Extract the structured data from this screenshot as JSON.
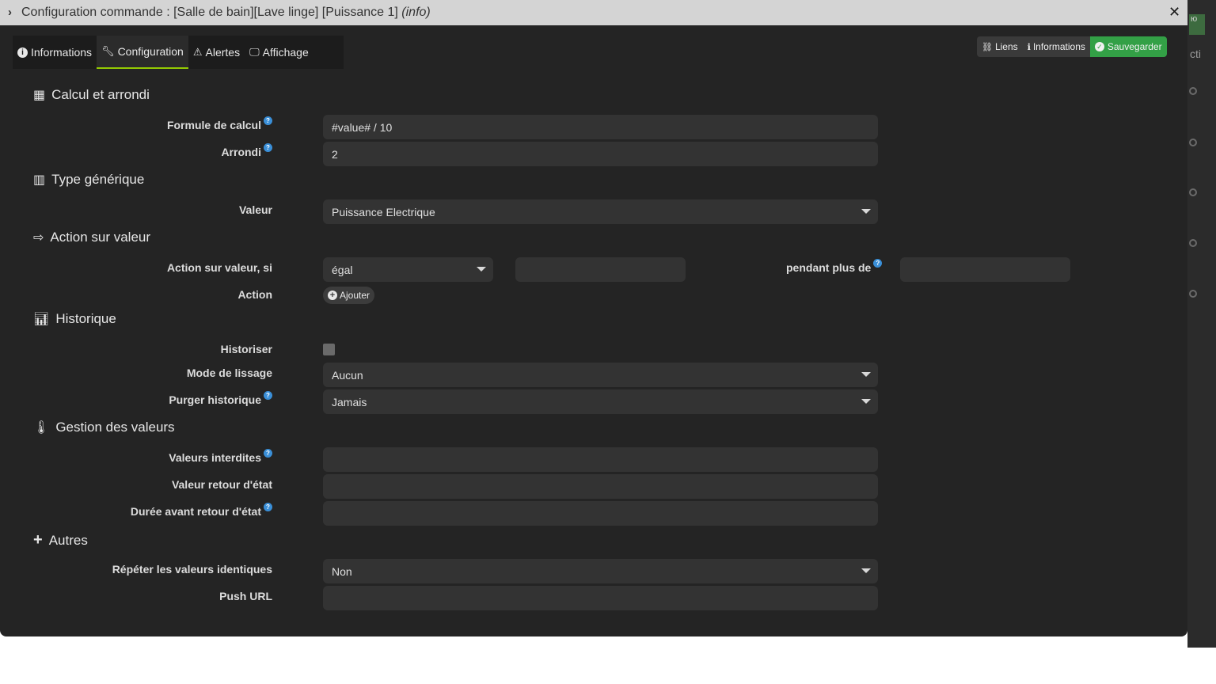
{
  "window": {
    "title_prefix": "Configuration commande : [Salle de bain][Lave linge] [Puissance 1]",
    "title_suffix": "(info)",
    "close_glyph": "✕"
  },
  "tabs": [
    {
      "label": "Informations",
      "icon": "info-circle-icon",
      "active": false
    },
    {
      "label": "Configuration",
      "icon": "wrench-icon",
      "active": true
    },
    {
      "label": "Alertes",
      "icon": "warning-icon",
      "active": false
    },
    {
      "label": "Affichage",
      "icon": "monitor-icon",
      "active": false
    }
  ],
  "toolbar": {
    "links_label": "Liens",
    "info_label": "Informations",
    "save_label": "Sauvegarder",
    "save_color": "#33a046"
  },
  "sections": {
    "calcul": "Calcul et arrondi",
    "type": "Type générique",
    "action": "Action sur valeur",
    "historique": "Historique",
    "gestion": "Gestion des valeurs",
    "autres": "Autres"
  },
  "fields": {
    "formule": {
      "label": "Formule de calcul",
      "value": "#value# / 10"
    },
    "arrondi": {
      "label": "Arrondi",
      "value": "2"
    },
    "valeur": {
      "label": "Valeur",
      "value": "Puissance Electrique"
    },
    "action_si": {
      "label": "Action sur valeur, si",
      "operator": "égal",
      "value": "",
      "pendant_label": "pendant plus de",
      "pendant_value": ""
    },
    "action": {
      "label": "Action",
      "add_label": "Ajouter"
    },
    "historiser": {
      "label": "Historiser",
      "checked": false
    },
    "lissage": {
      "label": "Mode de lissage",
      "value": "Aucun"
    },
    "purger": {
      "label": "Purger historique",
      "value": "Jamais"
    },
    "interdites": {
      "label": "Valeurs interdites",
      "value": ""
    },
    "retour": {
      "label": "Valeur retour d'état",
      "value": ""
    },
    "duree": {
      "label": "Durée avant retour d'état",
      "value": ""
    },
    "repeter": {
      "label": "Répéter les valeurs identiques",
      "value": "Non"
    },
    "push": {
      "label": "Push URL",
      "value": ""
    }
  },
  "help_glyph": "?",
  "background": {
    "fragment_top": "ю",
    "fragment_mid": "cti"
  },
  "colors": {
    "accent": "#94ca02",
    "help": "#3a8fd8",
    "panel": "#242424"
  }
}
